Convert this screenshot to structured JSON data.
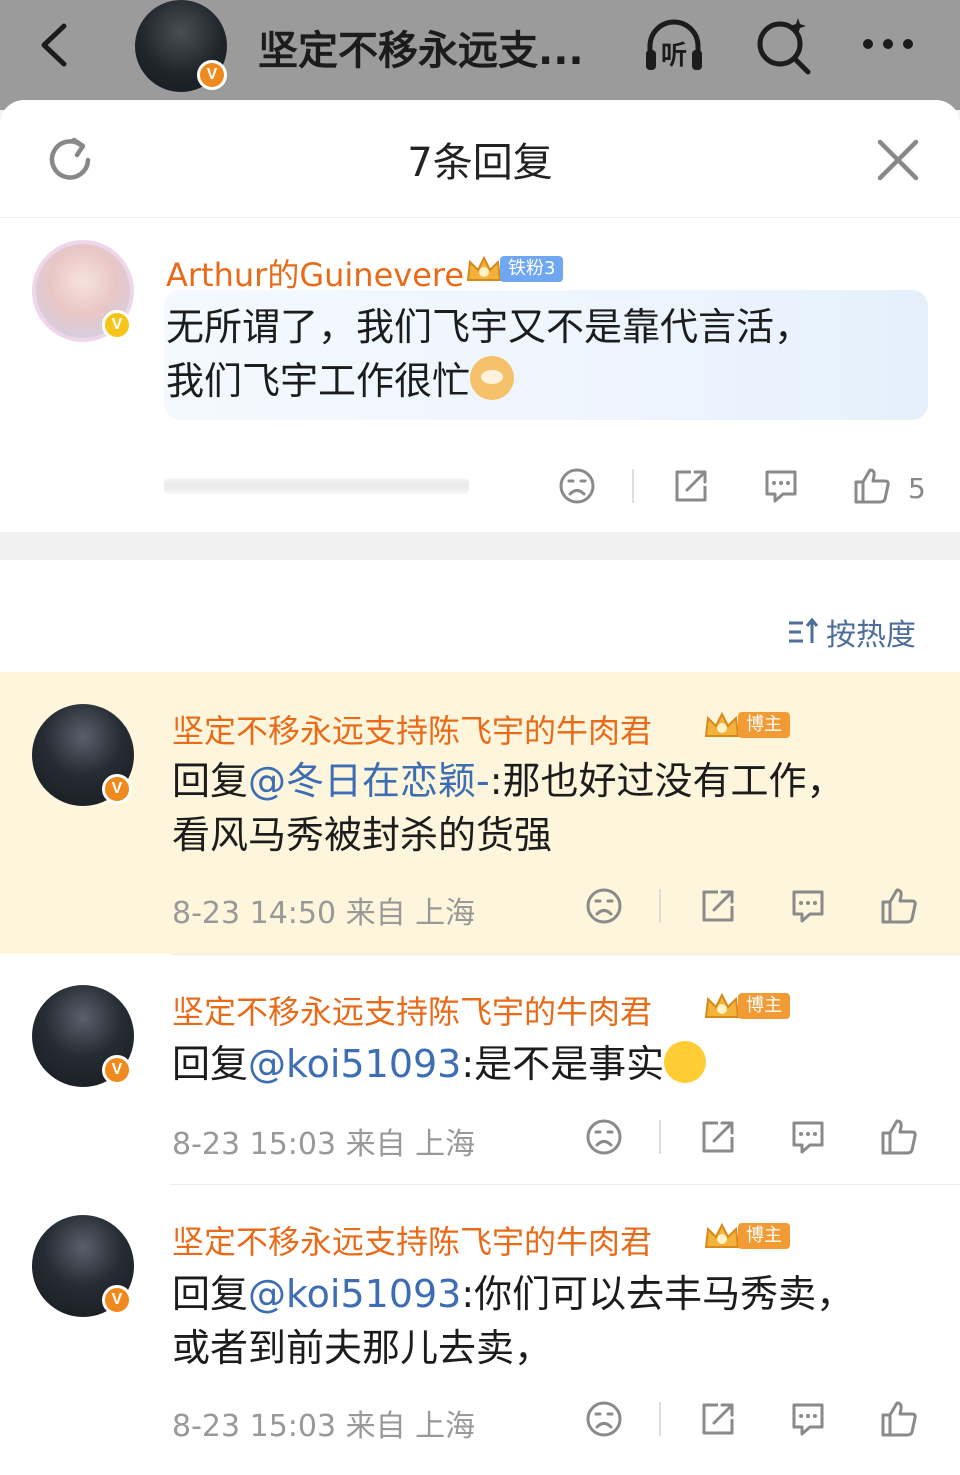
{
  "topbar": {
    "title": "坚定不移永远支...",
    "listen_label": "听"
  },
  "sheet": {
    "title": "7条回复"
  },
  "root_comment": {
    "username": "Arthur的Guinevere",
    "fan_badge": "铁粉3",
    "text_line1": "无所谓了，我们飞宇又不是靠代言活，",
    "text_line2": "我们飞宇工作很忙",
    "like_count": "5"
  },
  "sort": {
    "label": "按热度"
  },
  "replies": [
    {
      "username": "坚定不移永远支持陈飞宇的牛肉君",
      "badge": "博主",
      "prefix": "回复",
      "mention": "@冬日在恋颖-",
      "text_line1": ":那也好过没有工作，",
      "text_line2": "看风马秀被封杀的货强",
      "time": "8-23 14:50",
      "location": "来自 上海"
    },
    {
      "username": "坚定不移永远支持陈飞宇的牛肉君",
      "badge": "博主",
      "prefix": "回复",
      "mention": "@koi51093",
      "text_line1": ":是不是事实",
      "text_line2": "",
      "time": "8-23 15:03",
      "location": "来自 上海"
    },
    {
      "username": "坚定不移永远支持陈飞宇的牛肉君",
      "badge": "博主",
      "prefix": "回复",
      "mention": "@koi51093",
      "text_line1": ":你们可以去丰马秀卖，",
      "text_line2": "或者到前夫那儿去卖，",
      "time": "8-23 15:03",
      "location": "来自 上海"
    }
  ],
  "colors": {
    "username": "#e86b1a",
    "mention": "#3d6db3",
    "highlight_row": "#fdf6dc",
    "verified_badge": "#f08a1e"
  },
  "icons": [
    "back-arrow-icon",
    "headphones-icon",
    "search-icon",
    "more-icon",
    "refresh-icon",
    "close-icon",
    "dislike-face-icon",
    "share-icon",
    "comment-icon",
    "like-thumb-icon",
    "sort-icon",
    "crown-icon",
    "verified-icon"
  ]
}
